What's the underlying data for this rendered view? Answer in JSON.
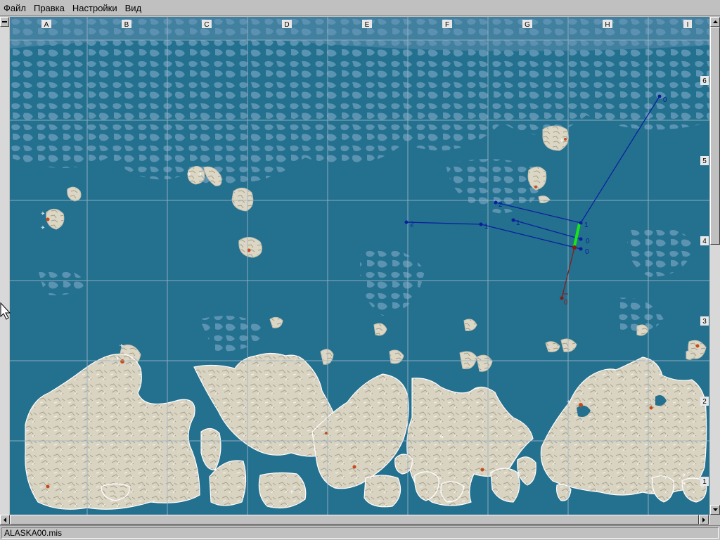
{
  "menu": [
    {
      "id": "file",
      "label": "Файл"
    },
    {
      "id": "edit",
      "label": "Правка"
    },
    {
      "id": "settings",
      "label": "Настройки"
    },
    {
      "id": "view",
      "label": "Вид"
    }
  ],
  "map": {
    "columns": [
      "A",
      "B",
      "C",
      "D",
      "E",
      "F",
      "G",
      "H",
      "I"
    ],
    "rows": [
      "6",
      "5",
      "4",
      "3",
      "2",
      "1"
    ],
    "colors": {
      "water": "#23708f",
      "ice": "#6e9fbd",
      "land": "#d9d3c2",
      "grid": "#9fb6c3",
      "route_blue": "#0a1e9e",
      "route_red": "#8b1a12",
      "highlight": "#19e319"
    },
    "routes": {
      "blue_a": {
        "labels": [
          "0",
          "1",
          "2"
        ]
      },
      "blue_b": {
        "labels": [
          "0",
          "1"
        ]
      },
      "blue_c": {
        "labels": [
          "0",
          "1",
          "2"
        ]
      },
      "red_a": {
        "labels": [
          "0"
        ]
      }
    }
  },
  "statusbar": {
    "text": "ALASKA00.mis"
  }
}
